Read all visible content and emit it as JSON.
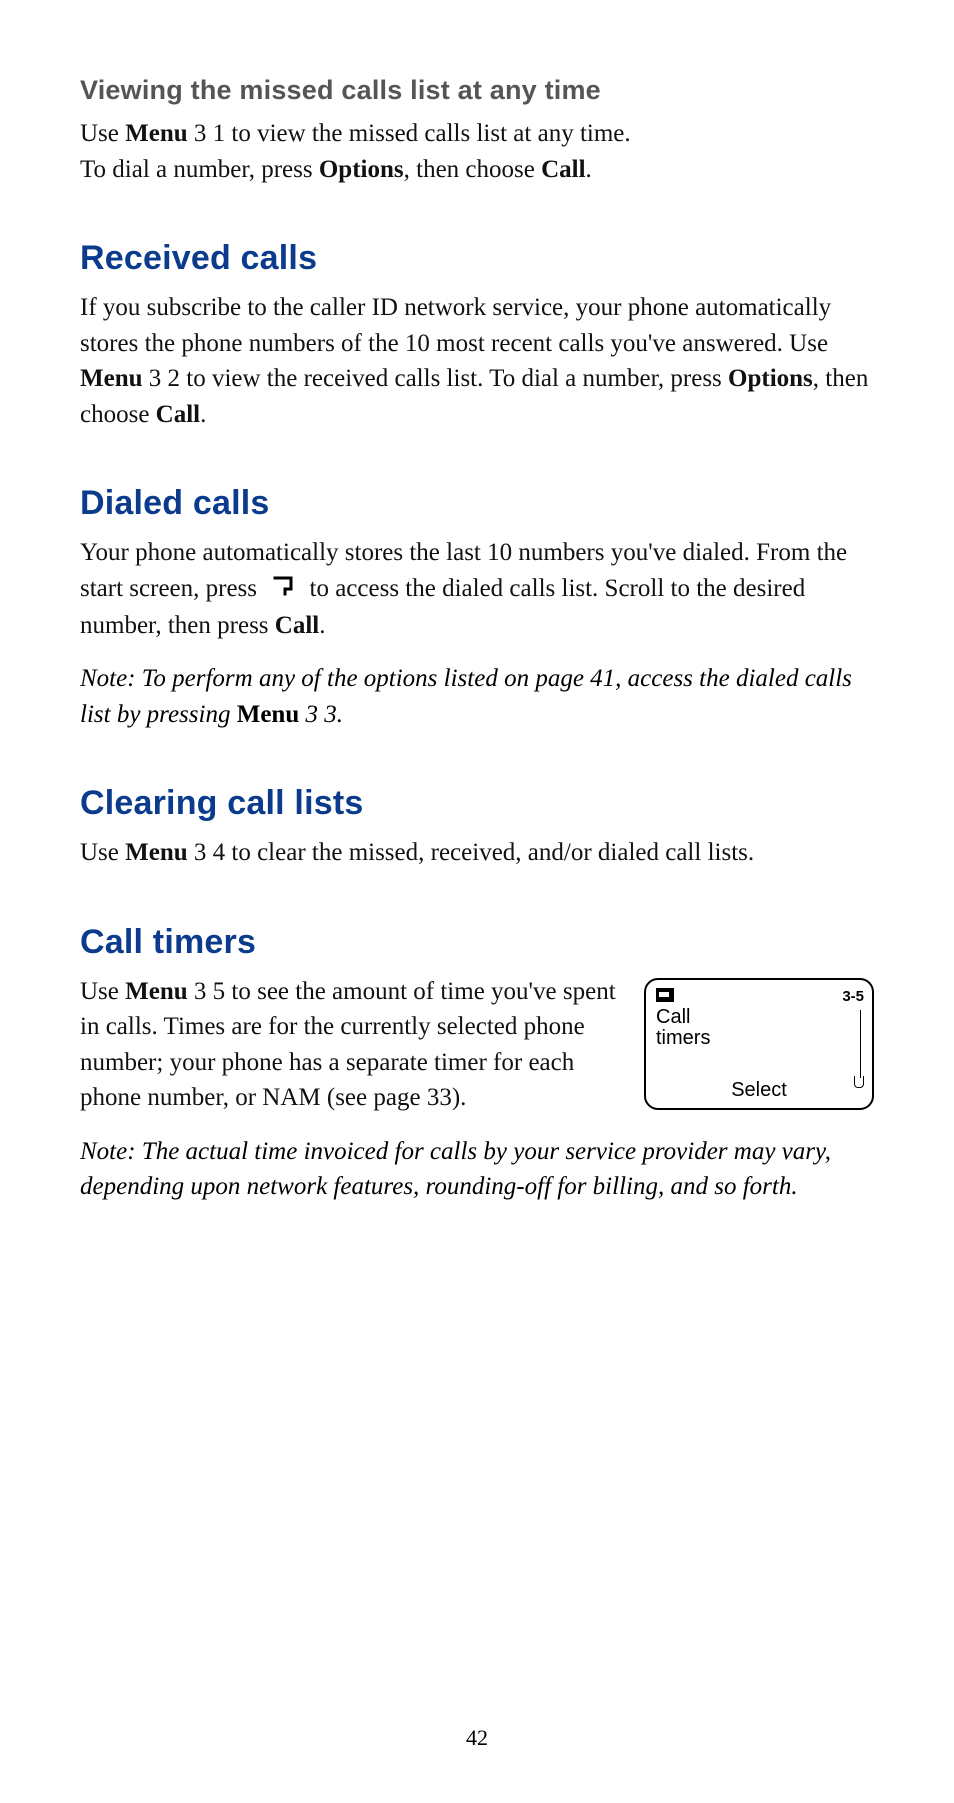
{
  "missed": {
    "subheading": "Viewing the missed calls list at any time",
    "p1_a": "Use ",
    "p1_menu": "Menu",
    "p1_b": " 3 1 to view the missed calls list at any time.",
    "p2_a": "To dial a number, press ",
    "p2_options": "Options",
    "p2_b": ", then choose ",
    "p2_call": "Call",
    "p2_c": "."
  },
  "received": {
    "heading": "Received calls",
    "p_a": "If you subscribe to the caller ID network service, your phone automatically stores the phone numbers of the 10 most recent calls you've answered. Use ",
    "p_menu": "Menu",
    "p_b": " 3 2 to view the received calls list. To dial a number, press ",
    "p_options": "Options",
    "p_c": ", then choose ",
    "p_call": "Call",
    "p_d": "."
  },
  "dialed": {
    "heading": "Dialed calls",
    "p_a": "Your phone automatically stores the last 10 numbers you've dialed. From the start screen, press ",
    "p_b": " to access the dialed calls list. Scroll to the desired number, then press ",
    "p_call": "Call",
    "p_c": ".",
    "note_a": "Note:  To perform any of the options listed on page 41, access the dialed calls list by pressing ",
    "note_menu": "Menu",
    "note_b": " 3 3."
  },
  "clearing": {
    "heading": "Clearing call lists",
    "p_a": "Use ",
    "p_menu": "Menu",
    "p_b": " 3 4 to clear the missed, received, and/or dialed call lists."
  },
  "timers": {
    "heading": "Call timers",
    "p_a": "Use ",
    "p_menu": "Menu",
    "p_b": " 3 5 to see the amount of time you've spent in calls. Times are for the currently selected phone number; your phone has a separate timer for each phone number, or NAM (see page 33).",
    "note": "Note:  The actual time invoiced for calls by your service provider may vary, depending upon network features, rounding-off for billing, and so forth.",
    "screen": {
      "title_l1": "Call",
      "title_l2": "timers",
      "index": "3-5",
      "softkey": "Select"
    }
  },
  "page_number": "42"
}
